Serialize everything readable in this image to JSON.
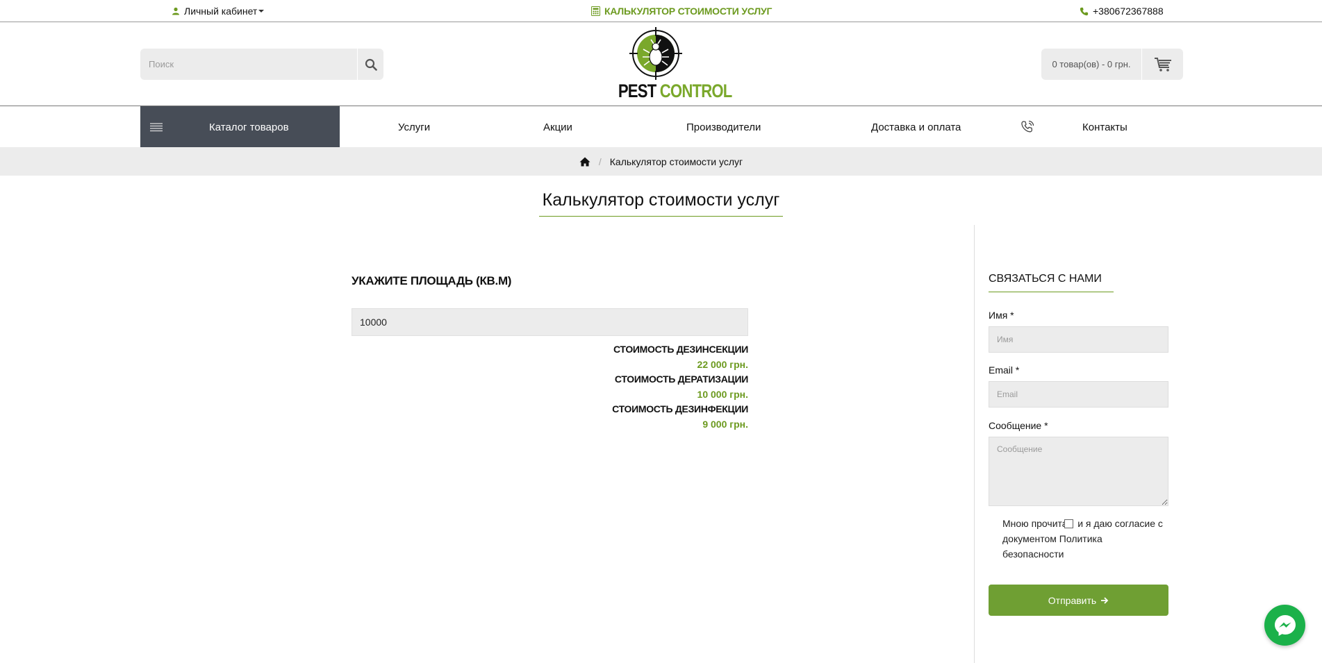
{
  "topbar": {
    "account_label": "Личный кабинет",
    "calculator_label": "КАЛЬКУЛЯТОР СТОИМОСТИ УСЛУГ",
    "phone": "+380672367888"
  },
  "header": {
    "search_placeholder": "Поиск",
    "logo_word1": "PEST",
    "logo_word2": "CONTROL",
    "cart_label": "0 товар(ов) - 0 грн."
  },
  "nav": {
    "catalog": "Каталог товаров",
    "items": [
      "Услуги",
      "Акции",
      "Производители",
      "Доставка и оплата",
      "Контакты"
    ]
  },
  "breadcrumb": {
    "current": "Калькулятор стоимости услуг"
  },
  "page": {
    "title": "Калькулятор стоимости услуг"
  },
  "calculator": {
    "heading": "УКАЖИТЕ ПЛОЩАДЬ (КВ.М)",
    "area_value": "10000",
    "results": [
      {
        "label": "СТОИМОСТЬ ДЕЗИНСЕКЦИИ",
        "value": "22 000 грн."
      },
      {
        "label": "СТОИМОСТЬ ДЕРАТИЗАЦИИ",
        "value": "10 000 грн."
      },
      {
        "label": "СТОИМОСТЬ ДЕЗИНФЕКЦИИ",
        "value": "9 000 грн."
      }
    ]
  },
  "contact_form": {
    "title": "СВЯЗАТЬСЯ С НАМИ",
    "name_label": "Имя",
    "name_placeholder": "Имя",
    "email_label": "Email",
    "email_placeholder": "Email",
    "message_label": "Сообщение",
    "message_placeholder": "Сообщение",
    "required_mark": "*",
    "consent_part1": "Мною прочитан",
    "consent_part2": "и я даю согласие с документом",
    "consent_link": "Политика безопасности",
    "submit_label": "Отправить"
  },
  "colors": {
    "accent": "#6c9a1f",
    "catalog_bg": "#474d57",
    "messenger": "#1bb14a"
  }
}
